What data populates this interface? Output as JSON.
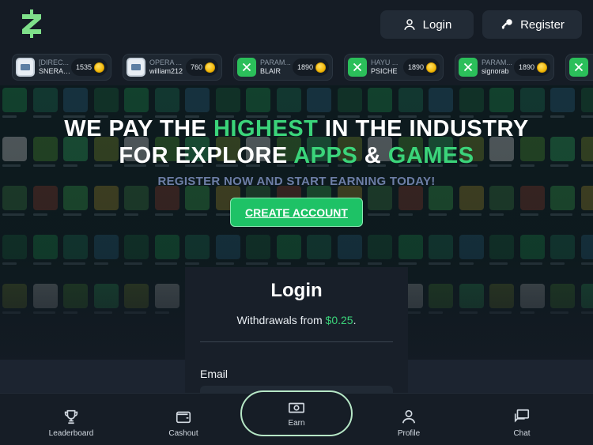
{
  "header": {
    "logo_icon": "zap-logo-icon",
    "login_label": "Login",
    "register_label": "Register"
  },
  "ticker": [
    {
      "title": "[DIREC...",
      "user": "SNERART",
      "amount": "1535",
      "icon": "app-icon"
    },
    {
      "title": "OPERA ...",
      "user": "william212",
      "amount": "760",
      "icon": "app-icon"
    },
    {
      "title": "PARAM...",
      "user": "BLAIR",
      "amount": "1890",
      "icon": "tool-icon"
    },
    {
      "title": "HAYU ...",
      "user": "PSICHE",
      "amount": "1890",
      "icon": "tool-icon"
    },
    {
      "title": "PARAM...",
      "user": "signorab",
      "amount": "1890",
      "icon": "tool-icon"
    }
  ],
  "hero": {
    "line1_a": "WE PAY THE ",
    "line1_b": "HIGHEST",
    "line1_c": " IN THE INDUSTRY",
    "line2_a": "FOR EXPLORE ",
    "line2_b": "APPS",
    "line2_c": " & ",
    "line2_d": "GAMES",
    "subline": "REGISTER NOW AND START EARNING TODAY!",
    "cta": "CREATE ACCOUNT"
  },
  "login_panel": {
    "title": "Login",
    "subtitle_prefix": "Withdrawals from ",
    "subtitle_amount": "$0.25",
    "subtitle_suffix": ".",
    "email_label": "Email"
  },
  "bottom_nav": {
    "leaderboard": "Leaderboard",
    "cashout": "Cashout",
    "earn": "Earn",
    "profile": "Profile",
    "chat": "Chat"
  },
  "colors": {
    "accent": "#3bd47a",
    "cta": "#1ec266",
    "background": "#141b24"
  }
}
